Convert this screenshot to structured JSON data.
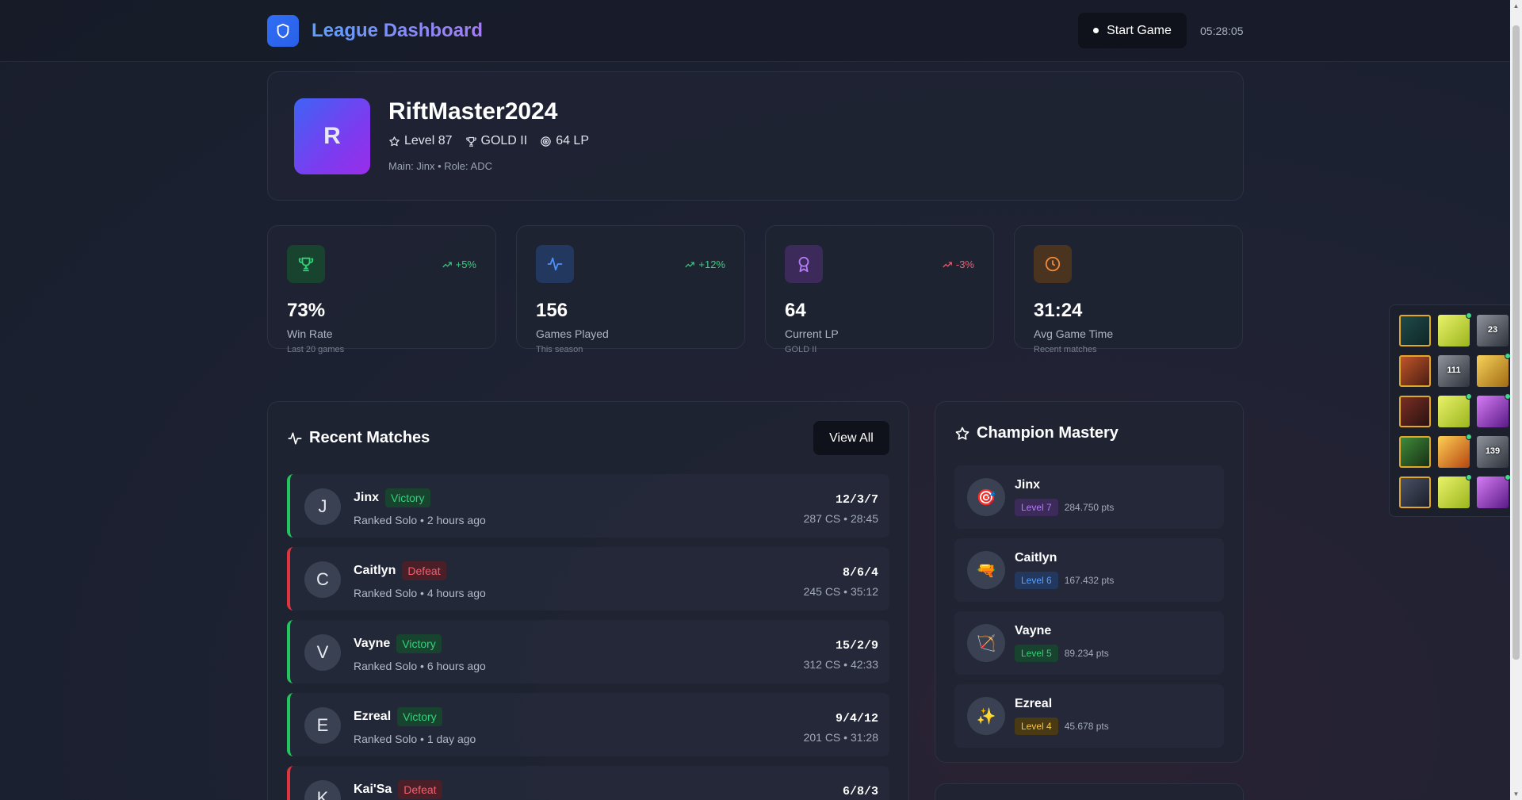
{
  "header": {
    "title": "League Dashboard",
    "start_button": "Start Game",
    "clock": "05:28:05"
  },
  "profile": {
    "avatar_letter": "R",
    "name": "RiftMaster2024",
    "level": "Level 87",
    "rank": "GOLD II",
    "lp": "64 LP",
    "sub": "Main: Jinx • Role: ADC"
  },
  "stats": [
    {
      "value": "73%",
      "label": "Win Rate",
      "sub": "Last 20 games",
      "trend": "+5%",
      "trend_dir": "up",
      "icon": "trophy-icon",
      "color": "#34d27a"
    },
    {
      "value": "156",
      "label": "Games Played",
      "sub": "This season",
      "trend": "+12%",
      "trend_dir": "up",
      "icon": "activity-icon",
      "color": "#4d8ef7"
    },
    {
      "value": "64",
      "label": "Current LP",
      "sub": "GOLD II",
      "trend": "-3%",
      "trend_dir": "down",
      "icon": "award-icon",
      "color": "#b37cf5"
    },
    {
      "value": "31:24",
      "label": "Avg Game Time",
      "sub": "Recent matches",
      "trend": "",
      "icon": "clock-icon",
      "color": "#f08a3a"
    }
  ],
  "matches": {
    "title": "Recent Matches",
    "view_all": "View All",
    "items": [
      {
        "letter": "J",
        "champion": "Jinx",
        "result": "Victory",
        "queue": "Ranked Solo • 2 hours ago",
        "kda": "12/3/7",
        "cs": "287 CS • 28:45"
      },
      {
        "letter": "C",
        "champion": "Caitlyn",
        "result": "Defeat",
        "queue": "Ranked Solo • 4 hours ago",
        "kda": "8/6/4",
        "cs": "245 CS • 35:12"
      },
      {
        "letter": "V",
        "champion": "Vayne",
        "result": "Victory",
        "queue": "Ranked Solo • 6 hours ago",
        "kda": "15/2/9",
        "cs": "312 CS • 42:33"
      },
      {
        "letter": "E",
        "champion": "Ezreal",
        "result": "Victory",
        "queue": "Ranked Solo • 1 day ago",
        "kda": "9/4/12",
        "cs": "201 CS • 31:28"
      },
      {
        "letter": "K",
        "champion": "Kai'Sa",
        "result": "Defeat",
        "queue": "",
        "kda": "6/8/3",
        "cs": ""
      }
    ]
  },
  "mastery": {
    "title": "Champion Mastery",
    "items": [
      {
        "champion": "Jinx",
        "level": "Level 7",
        "points": "284.750 pts",
        "emoji": "🎯",
        "color": "#b37cf5",
        "bg": "#3b2a5a"
      },
      {
        "champion": "Caitlyn",
        "level": "Level 6",
        "points": "167.432 pts",
        "emoji": "🔫",
        "color": "#5aa0ff",
        "bg": "#22385e"
      },
      {
        "champion": "Vayne",
        "level": "Level 5",
        "points": "89.234 pts",
        "emoji": "🏹",
        "color": "#34d27a",
        "bg": "#17432f"
      },
      {
        "champion": "Ezreal",
        "level": "Level 4",
        "points": "45.678 pts",
        "emoji": "✨",
        "color": "#f5c64a",
        "bg": "#4a3a14"
      }
    ]
  },
  "side_panel": {
    "tiles": [
      {
        "label": "",
        "kind": "champ-teal",
        "gold": true,
        "dot": false
      },
      {
        "label": "",
        "kind": "lime",
        "gold": false,
        "dot": true
      },
      {
        "label": "23",
        "kind": "grey",
        "gold": false,
        "dot": false
      },
      {
        "label": "",
        "kind": "champ-orange",
        "gold": true,
        "dot": false
      },
      {
        "label": "111",
        "kind": "grey",
        "gold": false,
        "dot": false
      },
      {
        "label": "",
        "kind": "gold-item",
        "gold": false,
        "dot": true
      },
      {
        "label": "",
        "kind": "champ-red",
        "gold": true,
        "dot": false
      },
      {
        "label": "",
        "kind": "lime",
        "gold": false,
        "dot": true
      },
      {
        "label": "",
        "kind": "purple",
        "gold": false,
        "dot": true
      },
      {
        "label": "",
        "kind": "champ-green",
        "gold": true,
        "dot": false
      },
      {
        "label": "",
        "kind": "fire",
        "gold": false,
        "dot": true
      },
      {
        "label": "139",
        "kind": "grey",
        "gold": false,
        "dot": false
      },
      {
        "label": "",
        "kind": "champ-dark",
        "gold": true,
        "dot": false
      },
      {
        "label": "",
        "kind": "lime",
        "gold": false,
        "dot": true
      },
      {
        "label": "",
        "kind": "purple",
        "gold": false,
        "dot": true
      }
    ]
  }
}
